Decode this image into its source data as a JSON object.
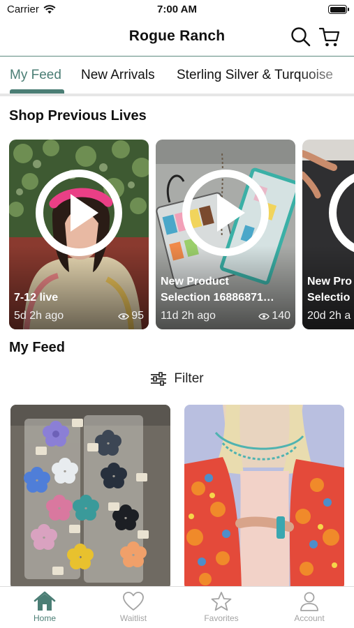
{
  "status_bar": {
    "carrier": "Carrier",
    "time": "7:00 AM"
  },
  "header": {
    "title": "Rogue Ranch",
    "search_icon": "search-icon",
    "cart_icon": "cart-icon"
  },
  "tabs": [
    {
      "label": "My Feed",
      "active": true
    },
    {
      "label": "New Arrivals",
      "active": false
    },
    {
      "label": "Sterling Silver & Turquoise",
      "active": false
    }
  ],
  "previous_lives": {
    "title": "Shop Previous Lives",
    "cards": [
      {
        "title": "7-12 live",
        "age": "5d 2h ago",
        "views": "95"
      },
      {
        "title": "New Product\nSelection 16886871…",
        "age": "11d 2h ago",
        "views": "140"
      },
      {
        "title": "New Pro\nSelectio",
        "age": "20d 2h a",
        "views": ""
      }
    ]
  },
  "feed": {
    "title": "My Feed",
    "filter_label": "Filter"
  },
  "bottom_nav": [
    {
      "label": "Home",
      "icon": "home-icon",
      "active": true
    },
    {
      "label": "Waitlist",
      "icon": "heart-icon",
      "active": false
    },
    {
      "label": "Favorites",
      "icon": "star-icon",
      "active": false
    },
    {
      "label": "Account",
      "icon": "person-icon",
      "active": false
    }
  ],
  "colors": {
    "accent": "#4b7e75",
    "inactive": "#a3a3a3"
  }
}
